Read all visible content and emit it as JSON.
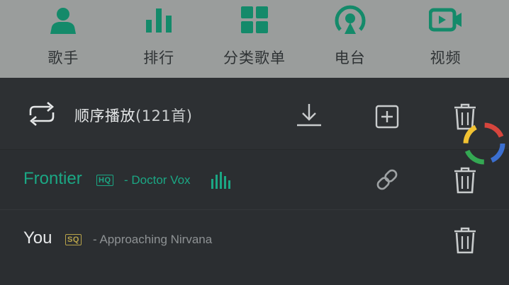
{
  "nav": {
    "items": [
      {
        "label": "歌手",
        "icon": "singer-icon"
      },
      {
        "label": "排行",
        "icon": "chart-icon"
      },
      {
        "label": "分类歌单",
        "icon": "category-icon"
      },
      {
        "label": "电台",
        "icon": "radio-icon"
      },
      {
        "label": "视频",
        "icon": "video-icon"
      }
    ]
  },
  "playlist": {
    "play_mode_label": "顺序播放",
    "count_text": "(121首)",
    "songs": [
      {
        "title": "Frontier",
        "badge": "HQ",
        "artist": "- Doctor Vox",
        "playing": true
      },
      {
        "title": "You",
        "badge": "SQ",
        "artist": "- Approaching Nirvana",
        "playing": false
      }
    ]
  },
  "colors": {
    "accent": "#1ba784",
    "nav_icon": "#148a6a",
    "sq_badge": "#b8a34a",
    "sheet_bg": "#2b2e31"
  }
}
